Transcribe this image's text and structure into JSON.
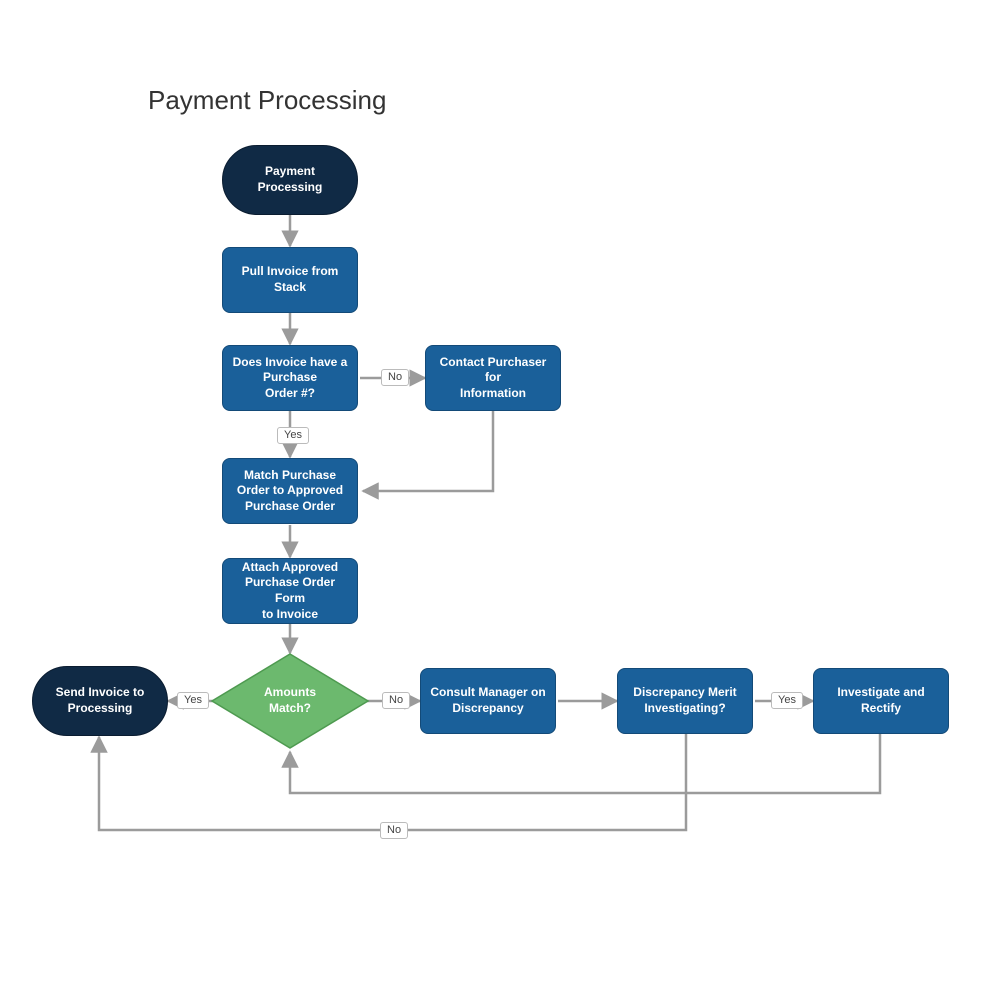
{
  "title": "Payment Processing",
  "nodes": {
    "start": {
      "label": "Payment\nProcessing"
    },
    "pull": {
      "label": "Pull  Invoice from\nStack"
    },
    "havePO": {
      "label": "Does Invoice have a\nPurchase\nOrder #?"
    },
    "contact": {
      "label": "Contact Purchaser for\nInformation"
    },
    "match": {
      "label": "Match  Purchase\nOrder to Approved\nPurchase Order"
    },
    "attach": {
      "label": "Attach Approved\nPurchase Order Form\nto Invoice"
    },
    "amounts": {
      "label": "Amounts\nMatch?"
    },
    "send": {
      "label": "Send Invoice to\nProcessing"
    },
    "consult": {
      "label": "Consult Manager on\nDiscrepancy"
    },
    "merit": {
      "label": "Discrepancy Merit\nInvestigating?"
    },
    "investigate": {
      "label": "Investigate and Rectify"
    }
  },
  "edgeLabels": {
    "havePO_no": "No",
    "havePO_yes": "Yes",
    "amounts_yes": "Yes",
    "amounts_no": "No",
    "merit_yes": "Yes",
    "merit_no": "No"
  },
  "colors": {
    "terminator": "#102a45",
    "process": "#1a609a",
    "decision": "#6cb96e",
    "arrow": "#9b9b9b"
  }
}
